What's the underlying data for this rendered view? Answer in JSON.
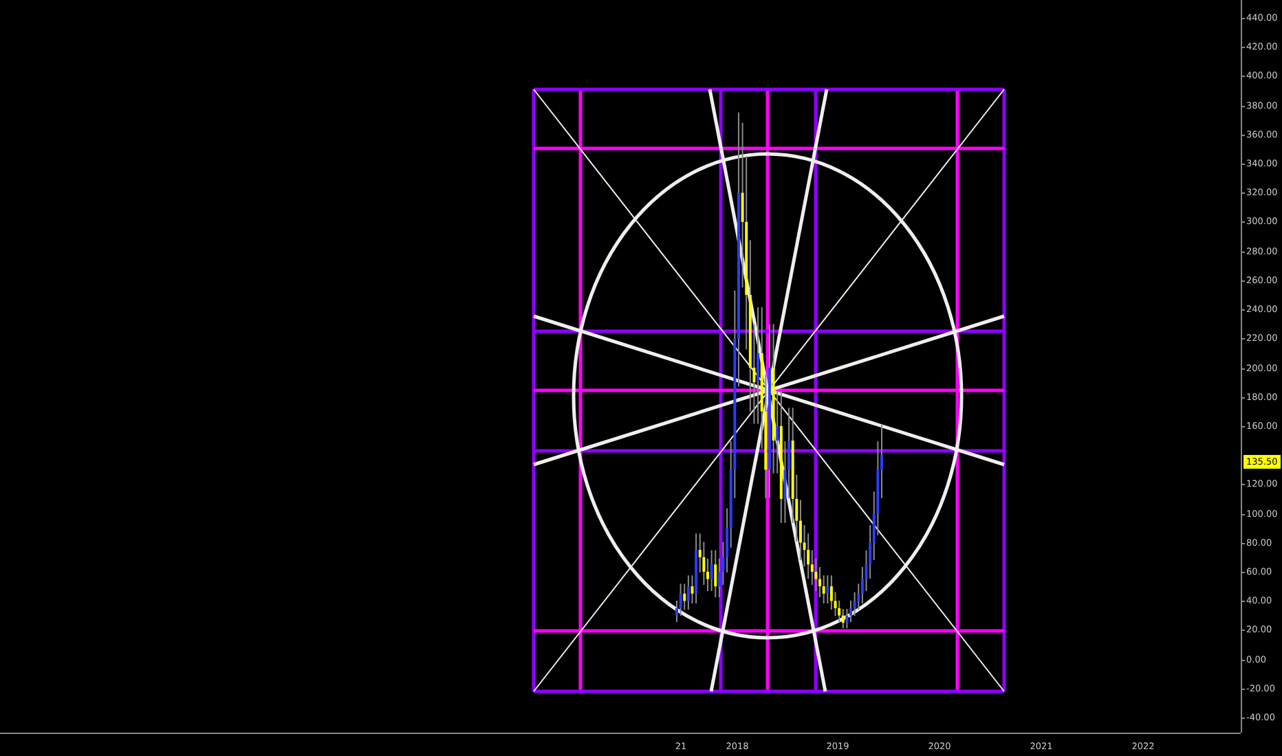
{
  "price_axis": {
    "upper_labels": [
      "440.00",
      "420.00",
      "400.00",
      "380.00",
      "360.00",
      "340.00",
      "320.00",
      "300.00",
      "280.00",
      "260.00",
      "240.00",
      "220.00",
      "200.00",
      "180.00",
      "160.00"
    ],
    "last_price": "135.50",
    "lower_labels": [
      "120.00",
      "100.00",
      "80.00",
      "60.00",
      "40.00",
      "20.00",
      "0.00",
      "-20.00",
      "-40.00"
    ]
  },
  "time_axis": {
    "labels": [
      "21",
      "2018",
      "2019",
      "2020",
      "2021",
      "2022"
    ]
  }
}
